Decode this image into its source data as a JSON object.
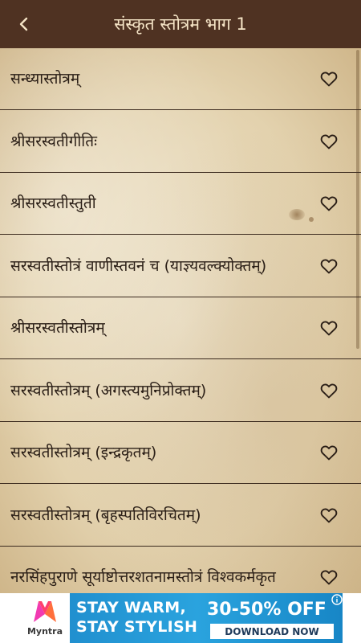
{
  "header": {
    "title": "संस्कृत स्तोत्रम भाग 1",
    "back_icon": "chevron-left-icon",
    "background_color": "#4f3222",
    "title_color": "#f5e4c6"
  },
  "list": {
    "items": [
      {
        "label": "सन्ध्यास्तोत्रम्",
        "icon": "heart-outline-icon"
      },
      {
        "label": "श्रीसरस्वतीगीतिः",
        "icon": "heart-outline-icon"
      },
      {
        "label": "श्रीसरस्वतीस्तुती",
        "icon": "heart-outline-icon"
      },
      {
        "label": "सरस्वतीस्तोत्रं वाणीस्तवनं च (याज्ञ्यवल्क्योक्तम्)",
        "icon": "heart-outline-icon"
      },
      {
        "label": "श्रीसरस्वतीस्तोत्रम्",
        "icon": "heart-outline-icon"
      },
      {
        "label": "सरस्वतीस्तोत्रम् (अगस्त्यमुनिप्रोक्तम्)",
        "icon": "heart-outline-icon"
      },
      {
        "label": "सरस्वतीस्तोत्रम् (इन्द्रकृतम्)",
        "icon": "heart-outline-icon"
      },
      {
        "label": "सरस्वतीस्तोत्रम् (बृहस्पतिविरचितम्)",
        "icon": "heart-outline-icon"
      },
      {
        "label": "नरसिंहपुराणे सूर्याष्टोत्तरशतनामस्तोत्रं विश्वकर्मकृत",
        "icon": "heart-outline-icon"
      }
    ]
  },
  "ad": {
    "brand": "Myntra",
    "line1": "STAY WARM,",
    "line2": "STAY STYLISH",
    "offer": "30-50% OFF",
    "cta": "DOWNLOAD NOW",
    "info_icon": "info-icon",
    "close_icon": "close-icon"
  }
}
